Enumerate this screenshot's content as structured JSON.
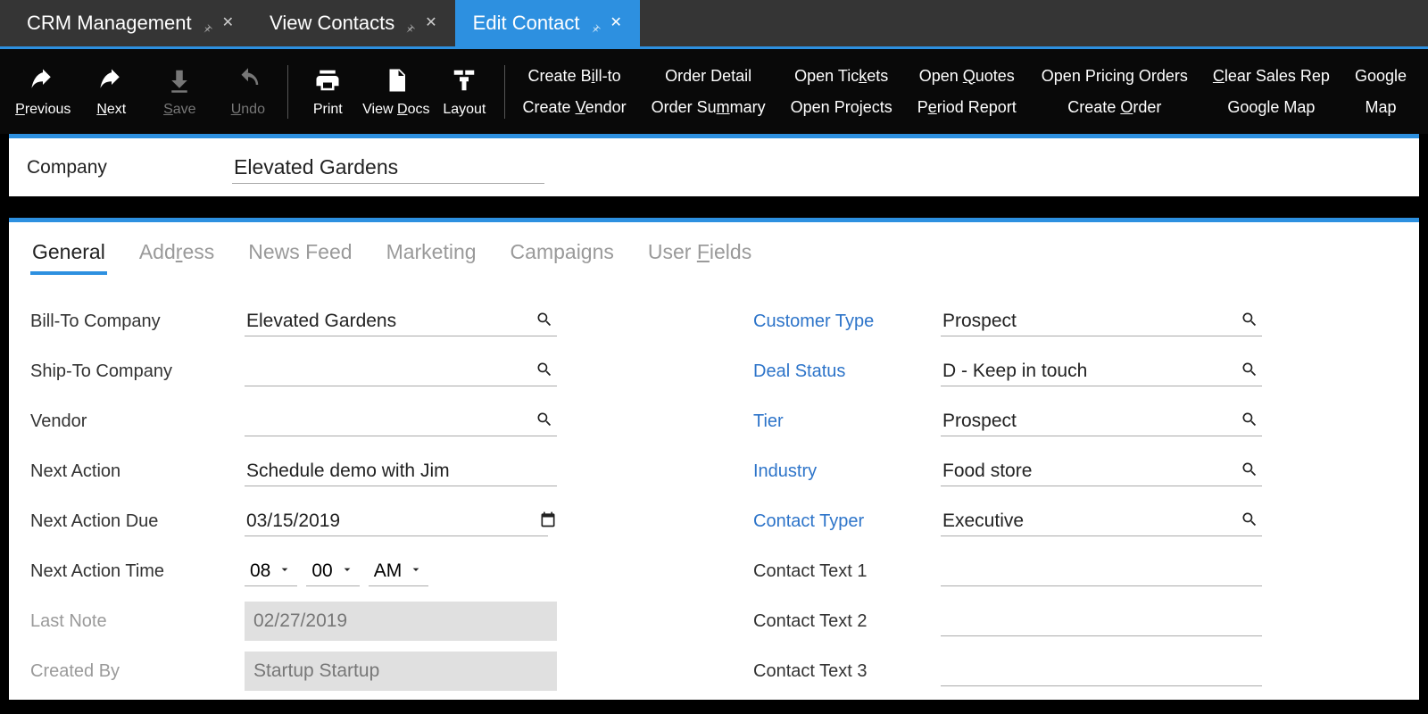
{
  "tabs": [
    {
      "label": "CRM Management",
      "active": false
    },
    {
      "label": "View Contacts",
      "active": false
    },
    {
      "label": "Edit Contact",
      "active": true
    }
  ],
  "toolbar": {
    "previous": "Previous",
    "next": "Next",
    "save": "Save",
    "undo": "Undo",
    "print": "Print",
    "viewdocs": "View Docs",
    "layout": "Layout",
    "links": {
      "create_billto": "Create Bill-to",
      "create_vendor": "Create Vendor",
      "order_detail": "Order Detail",
      "order_summary": "Order Summary",
      "open_tickets": "Open Tickets",
      "open_projects": "Open Projects",
      "open_quotes": "Open Quotes",
      "period_report": "Period Report",
      "open_pricing_orders": "Open Pricing Orders",
      "create_order": "Create Order",
      "clear_sales_rep": "Clear Sales Rep",
      "google_map": "Google Map"
    }
  },
  "company_bar": {
    "label": "Company",
    "value": "Elevated Gardens"
  },
  "subtabs": [
    "General",
    "Address",
    "News Feed",
    "Marketing",
    "Campaigns",
    "User Fields"
  ],
  "active_subtab": "General",
  "left_fields": {
    "bill_to": {
      "label": "Bill-To Company",
      "value": "Elevated Gardens"
    },
    "ship_to": {
      "label": "Ship-To Company",
      "value": ""
    },
    "vendor": {
      "label": "Vendor",
      "value": ""
    },
    "next_action": {
      "label": "Next Action",
      "value": "Schedule demo with Jim"
    },
    "next_action_due": {
      "label": "Next Action Due",
      "value": "03/15/2019"
    },
    "next_action_time": {
      "label": "Next Action Time",
      "hour": "08",
      "minute": "00",
      "ampm": "AM"
    },
    "last_note": {
      "label": "Last Note",
      "value": "02/27/2019"
    },
    "created_by": {
      "label": "Created By",
      "value": "Startup Startup"
    }
  },
  "right_fields": {
    "customer_type": {
      "label": "Customer Type",
      "value": "Prospect"
    },
    "deal_status": {
      "label": "Deal Status",
      "value": "D - Keep in touch"
    },
    "tier": {
      "label": "Tier",
      "value": "Prospect"
    },
    "industry": {
      "label": "Industry",
      "value": "Food store"
    },
    "contact_typer": {
      "label": "Contact Typer",
      "value": "Executive"
    },
    "contact_text1": {
      "label": "Contact Text 1",
      "value": ""
    },
    "contact_text2": {
      "label": "Contact Text 2",
      "value": ""
    },
    "contact_text3": {
      "label": "Contact Text 3",
      "value": ""
    }
  }
}
